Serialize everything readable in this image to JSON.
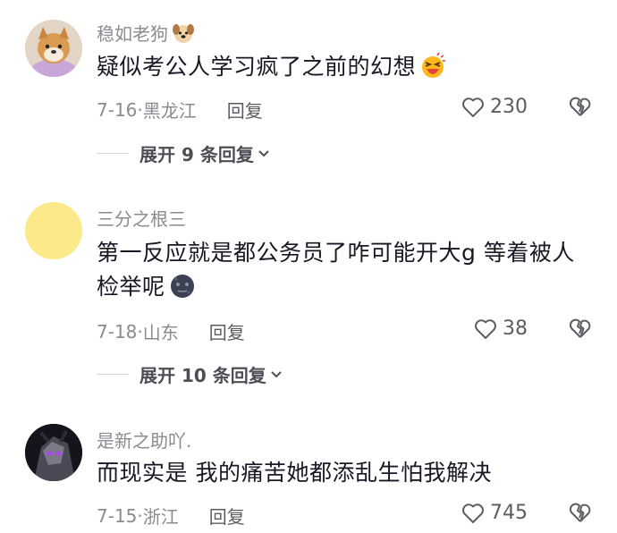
{
  "comments": [
    {
      "username": "稳如老狗",
      "username_emoji": "dog-face-icon",
      "text": "疑似考公人学习疯了之前的幻想",
      "text_emoji": "laughing-tears-emoji",
      "date": "7-16",
      "location": "黑龙江",
      "reply_label": "回复",
      "likes": "230",
      "expand_label": "展开 9 条回复"
    },
    {
      "username": "三分之根三",
      "text_line1": "第一反应就是都公务员了咋可能开大g 等着被人",
      "text_line2": "检举呢",
      "text_emoji": "new-moon-face-emoji",
      "date": "7-18",
      "location": "山东",
      "reply_label": "回复",
      "likes": "38",
      "expand_label": "展开 10 条回复"
    },
    {
      "username": "是新之助吖.",
      "text": "而现实是 我的痛苦她都添乱生怕我解决",
      "date": "7-15",
      "location": "浙江",
      "reply_label": "回复",
      "likes": "745"
    }
  ],
  "colors": {
    "text": "#161823",
    "secondary": "#8a8b91",
    "avatar2": "#fbe98a"
  }
}
